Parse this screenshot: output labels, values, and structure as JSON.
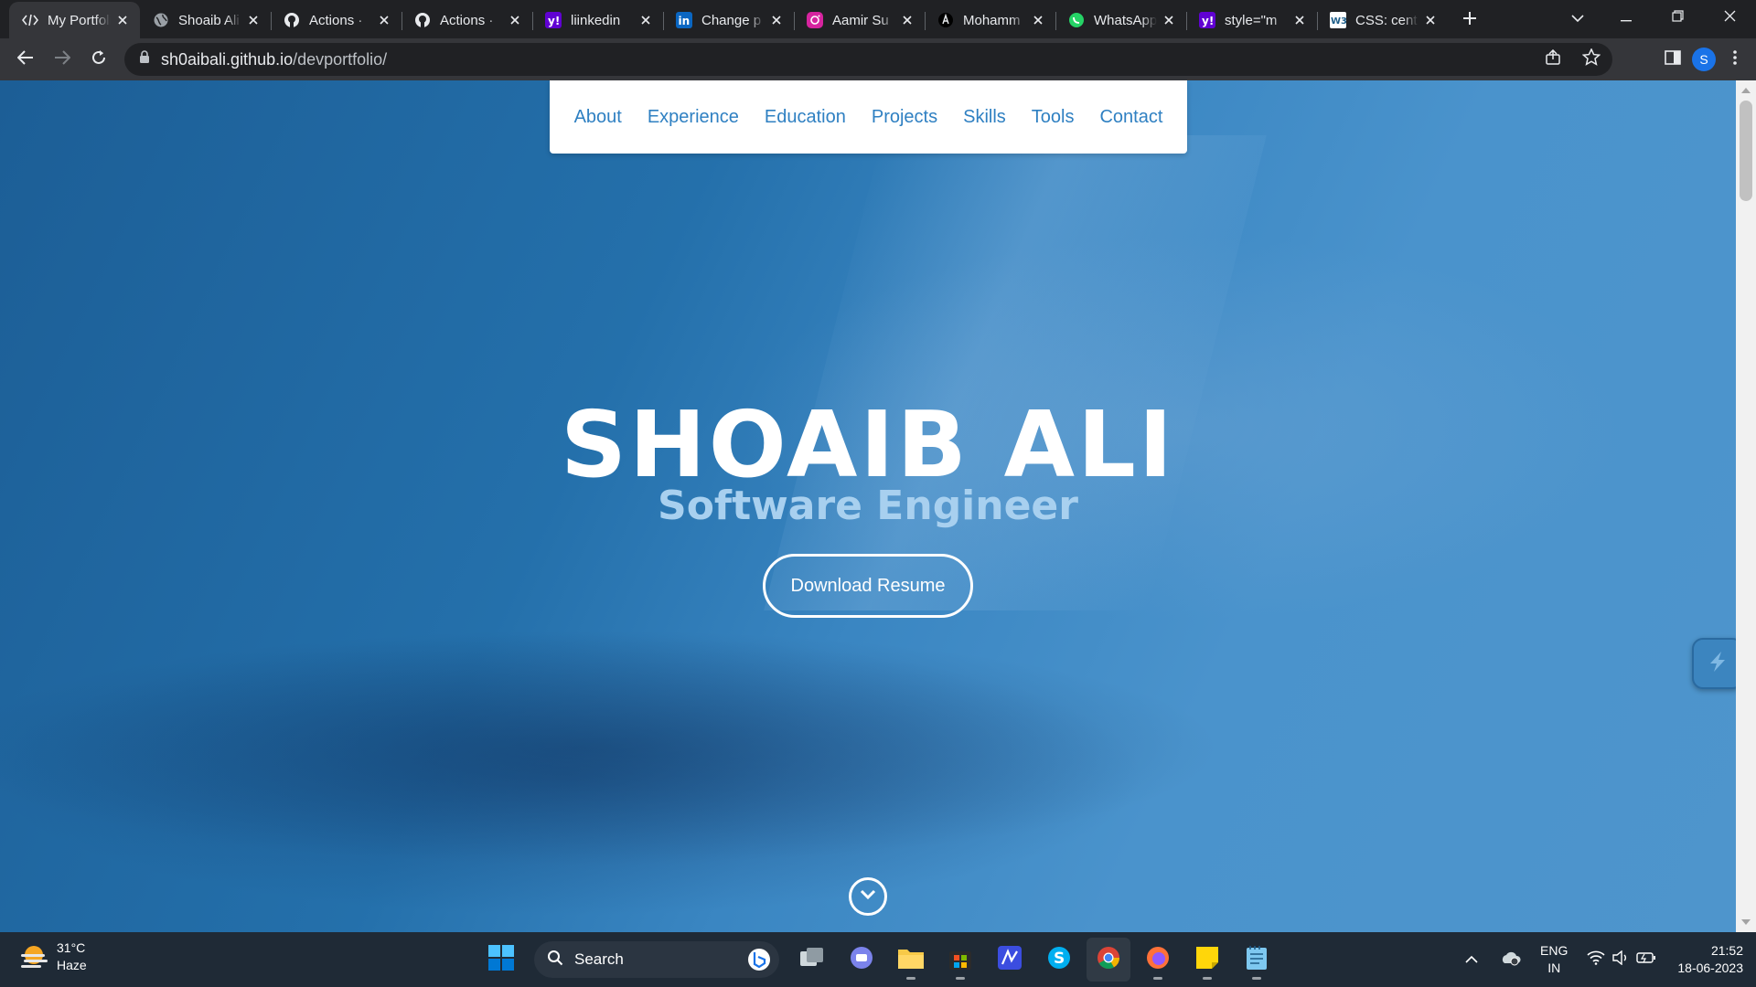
{
  "browser": {
    "tabs": [
      {
        "title": "My Portfolio",
        "icon": "code-icon",
        "active": true
      },
      {
        "title": "Shoaib Ali",
        "icon": "globe-icon"
      },
      {
        "title": "Actions · ",
        "icon": "github-icon"
      },
      {
        "title": "Actions · ",
        "icon": "github-icon"
      },
      {
        "title": "liinkedin",
        "icon": "yahoo-icon"
      },
      {
        "title": "Change p",
        "icon": "linkedin-icon"
      },
      {
        "title": "Aamir Su",
        "icon": "instagram-icon"
      },
      {
        "title": "Mohamm",
        "icon": "threads-icon"
      },
      {
        "title": "WhatsApp",
        "icon": "whatsapp-icon"
      },
      {
        "title": "style=\"m",
        "icon": "yahoo-icon"
      },
      {
        "title": "CSS: cent",
        "icon": "w3schools-icon"
      }
    ],
    "url_host": "sh0aibali.github.io",
    "url_path": "/devportfolio/",
    "profile_initial": "S"
  },
  "site": {
    "nav": [
      "About",
      "Experience",
      "Education",
      "Projects",
      "Skills",
      "Tools",
      "Contact"
    ],
    "name": "SHOAIB ALI",
    "role": "Software Engineer",
    "resume_label": "Download Resume"
  },
  "taskbar": {
    "weather_temp": "31°C",
    "weather_desc": "Haze",
    "search_placeholder": "Search",
    "lang_top": "ENG",
    "lang_bottom": "IN",
    "time": "21:52",
    "date": "18-06-2023"
  },
  "colors": {
    "accent": "#2f80c2",
    "hero_bg": "#3a86c2",
    "role_text": "#a8d0ef"
  }
}
